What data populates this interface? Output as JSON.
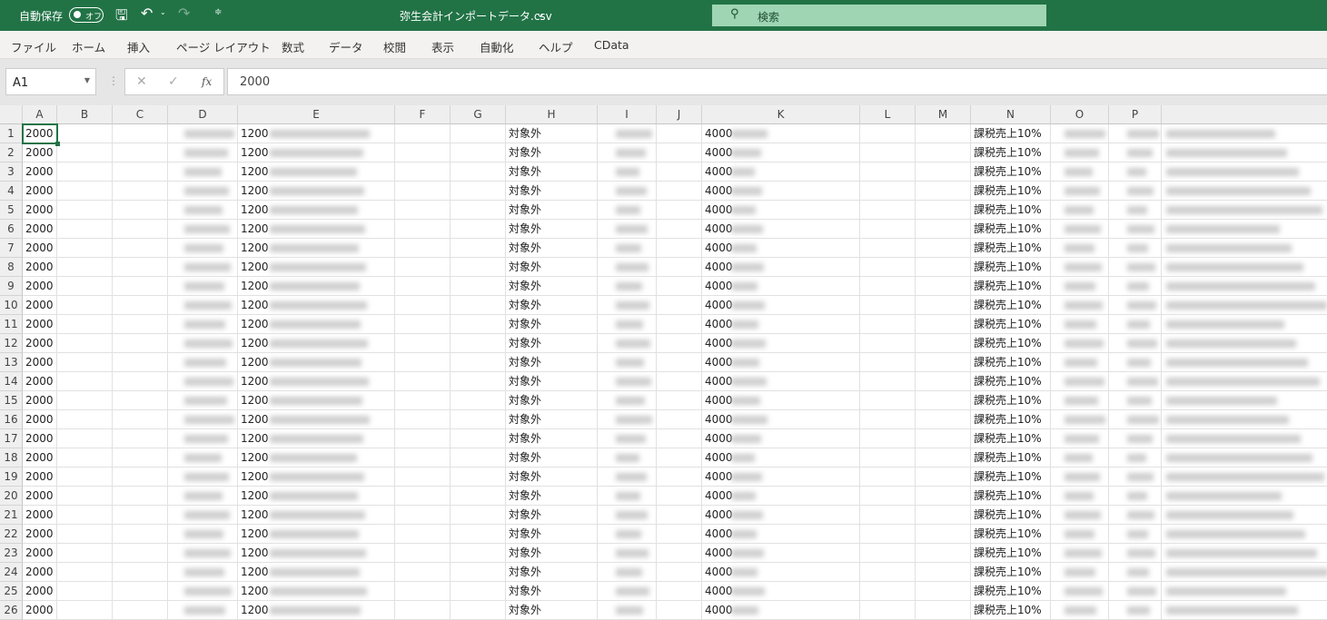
{
  "title_bar": {
    "autosave_label": "自動保存",
    "autosave_state": "オフ",
    "file_name": "弥生会計インポートデータ.csv",
    "search_placeholder": "検索"
  },
  "ribbon_tabs": [
    "ファイル",
    "ホーム",
    "挿入",
    "ページ レイアウト",
    "数式",
    "データ",
    "校閲",
    "表示",
    "自動化",
    "ヘルプ",
    "CData"
  ],
  "formula_bar": {
    "name_box": "A1",
    "fx_label": "fx",
    "formula": "2000"
  },
  "columns": [
    "A",
    "B",
    "C",
    "D",
    "E",
    "F",
    "G",
    "H",
    "I",
    "J",
    "K",
    "L",
    "M",
    "N",
    "O",
    "P"
  ],
  "row_numbers": [
    1,
    2,
    3,
    4,
    5,
    6,
    7,
    8,
    9,
    10,
    11,
    12,
    13,
    14,
    15,
    16,
    17,
    18,
    19,
    20,
    21,
    22,
    23,
    24,
    25,
    26
  ],
  "row_values": {
    "A": "2000",
    "E": "1200",
    "H": "対象外",
    "K": "4000",
    "N": "課税売上10%"
  },
  "selected_cell": "A1",
  "colors": {
    "accent": "#217346",
    "search_bg": "#9fd5b3"
  }
}
